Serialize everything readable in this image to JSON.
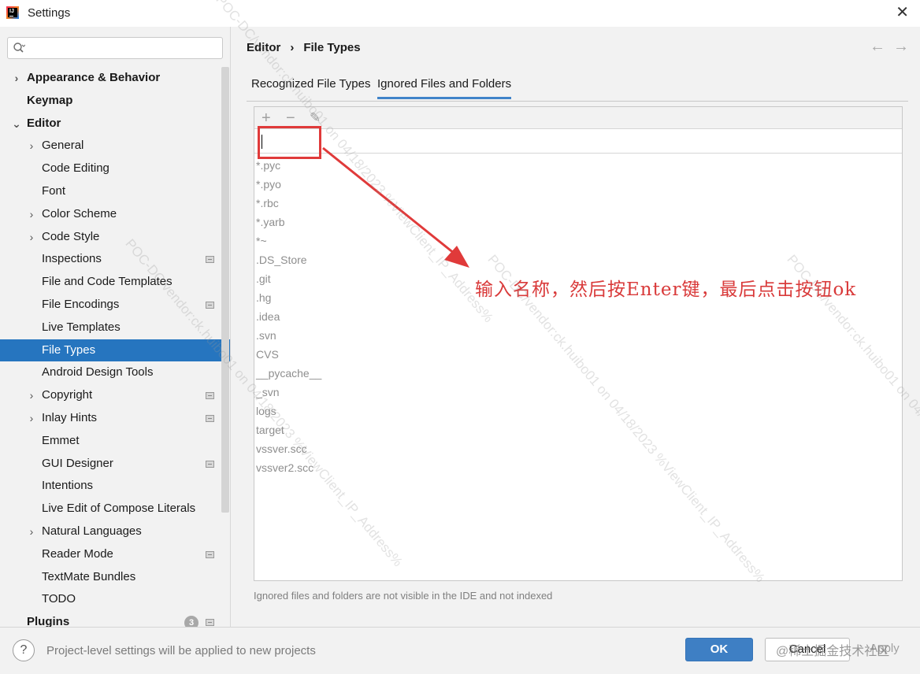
{
  "window": {
    "title": "Settings",
    "close_glyph": "✕"
  },
  "search": {
    "placeholder": ""
  },
  "sidebar": {
    "items": [
      {
        "label": "Appearance & Behavior",
        "bold": true,
        "level": 0,
        "chevron": "›",
        "scope": false
      },
      {
        "label": "Keymap",
        "bold": true,
        "level": 0,
        "chevron": "",
        "scope": false
      },
      {
        "label": "Editor",
        "bold": true,
        "level": 0,
        "chevron": "⌄",
        "scope": false
      },
      {
        "label": "General",
        "level": 1,
        "chevron": "›",
        "scope": false
      },
      {
        "label": "Code Editing",
        "level": 1,
        "chevron": "",
        "scope": false
      },
      {
        "label": "Font",
        "level": 1,
        "chevron": "",
        "scope": false
      },
      {
        "label": "Color Scheme",
        "level": 1,
        "chevron": "›",
        "scope": false
      },
      {
        "label": "Code Style",
        "level": 1,
        "chevron": "›",
        "scope": false
      },
      {
        "label": "Inspections",
        "level": 1,
        "chevron": "",
        "scope": true
      },
      {
        "label": "File and Code Templates",
        "level": 1,
        "chevron": "",
        "scope": false
      },
      {
        "label": "File Encodings",
        "level": 1,
        "chevron": "",
        "scope": true
      },
      {
        "label": "Live Templates",
        "level": 1,
        "chevron": "",
        "scope": false
      },
      {
        "label": "File Types",
        "level": 1,
        "chevron": "",
        "scope": false,
        "selected": true
      },
      {
        "label": "Android Design Tools",
        "level": 1,
        "chevron": "",
        "scope": false
      },
      {
        "label": "Copyright",
        "level": 1,
        "chevron": "›",
        "scope": true
      },
      {
        "label": "Inlay Hints",
        "level": 1,
        "chevron": "›",
        "scope": true
      },
      {
        "label": "Emmet",
        "level": 1,
        "chevron": "",
        "scope": false
      },
      {
        "label": "GUI Designer",
        "level": 1,
        "chevron": "",
        "scope": true
      },
      {
        "label": "Intentions",
        "level": 1,
        "chevron": "",
        "scope": false
      },
      {
        "label": "Live Edit of Compose Literals",
        "level": 1,
        "chevron": "",
        "scope": false
      },
      {
        "label": "Natural Languages",
        "level": 1,
        "chevron": "›",
        "scope": false
      },
      {
        "label": "Reader Mode",
        "level": 1,
        "chevron": "",
        "scope": true
      },
      {
        "label": "TextMate Bundles",
        "level": 1,
        "chevron": "",
        "scope": false
      },
      {
        "label": "TODO",
        "level": 1,
        "chevron": "",
        "scope": false
      },
      {
        "label": "Plugins",
        "bold": true,
        "level": 0,
        "chevron": "",
        "scope": true,
        "badge": "3"
      }
    ]
  },
  "breadcrumb": {
    "parent": "Editor",
    "separator": "›",
    "current": "File Types"
  },
  "nav": {
    "back": "←",
    "forward": "→"
  },
  "tabs": [
    {
      "label": "Recognized File Types",
      "active": false
    },
    {
      "label": "Ignored Files and Folders",
      "active": true
    }
  ],
  "toolbar": {
    "add": "+",
    "remove": "−",
    "edit": "✎"
  },
  "patterns": [
    "*.pyc",
    "*.pyo",
    "*.rbc",
    "*.yarb",
    "*~",
    ".DS_Store",
    ".git",
    ".hg",
    ".idea",
    ".svn",
    "CVS",
    "__pycache__",
    "_svn",
    "logs",
    "target",
    "vssver.scc",
    "vssver2.scc"
  ],
  "annotation": {
    "text": "输入名称，然后按Enter键，最后点击按钮ok",
    "color": "#d93a3a"
  },
  "hint": "Ignored files and folders are not visible in the IDE and not indexed",
  "footer": {
    "help": "?",
    "note": "Project-level settings will be applied to new projects",
    "ok": "OK",
    "cancel": "Cancel",
    "apply": "Apply",
    "watermark": "@稀土掘金技术社区"
  },
  "watermarks": [
    "POC-DC/vendor:ck.huibo01 on 04/18/2023 %ViewClient_IP_Address%",
    "POC-DC/vendor:ck.huibo01 on 04/18/2023 %ViewClient_IP_Address%",
    "POC-DC/vendor:ck.huibo01 on 04/18/2023 %ViewClient_IP_Address%",
    "POC-DC/vendor:ck.huibo01 on 04/18/2023 %ViewClient_IP_Address%"
  ],
  "colors": {
    "selection": "#2675bf",
    "ok_button": "#3e7fc4",
    "tab_underline": "#4083c9",
    "highlight_box": "#e03a3a"
  }
}
